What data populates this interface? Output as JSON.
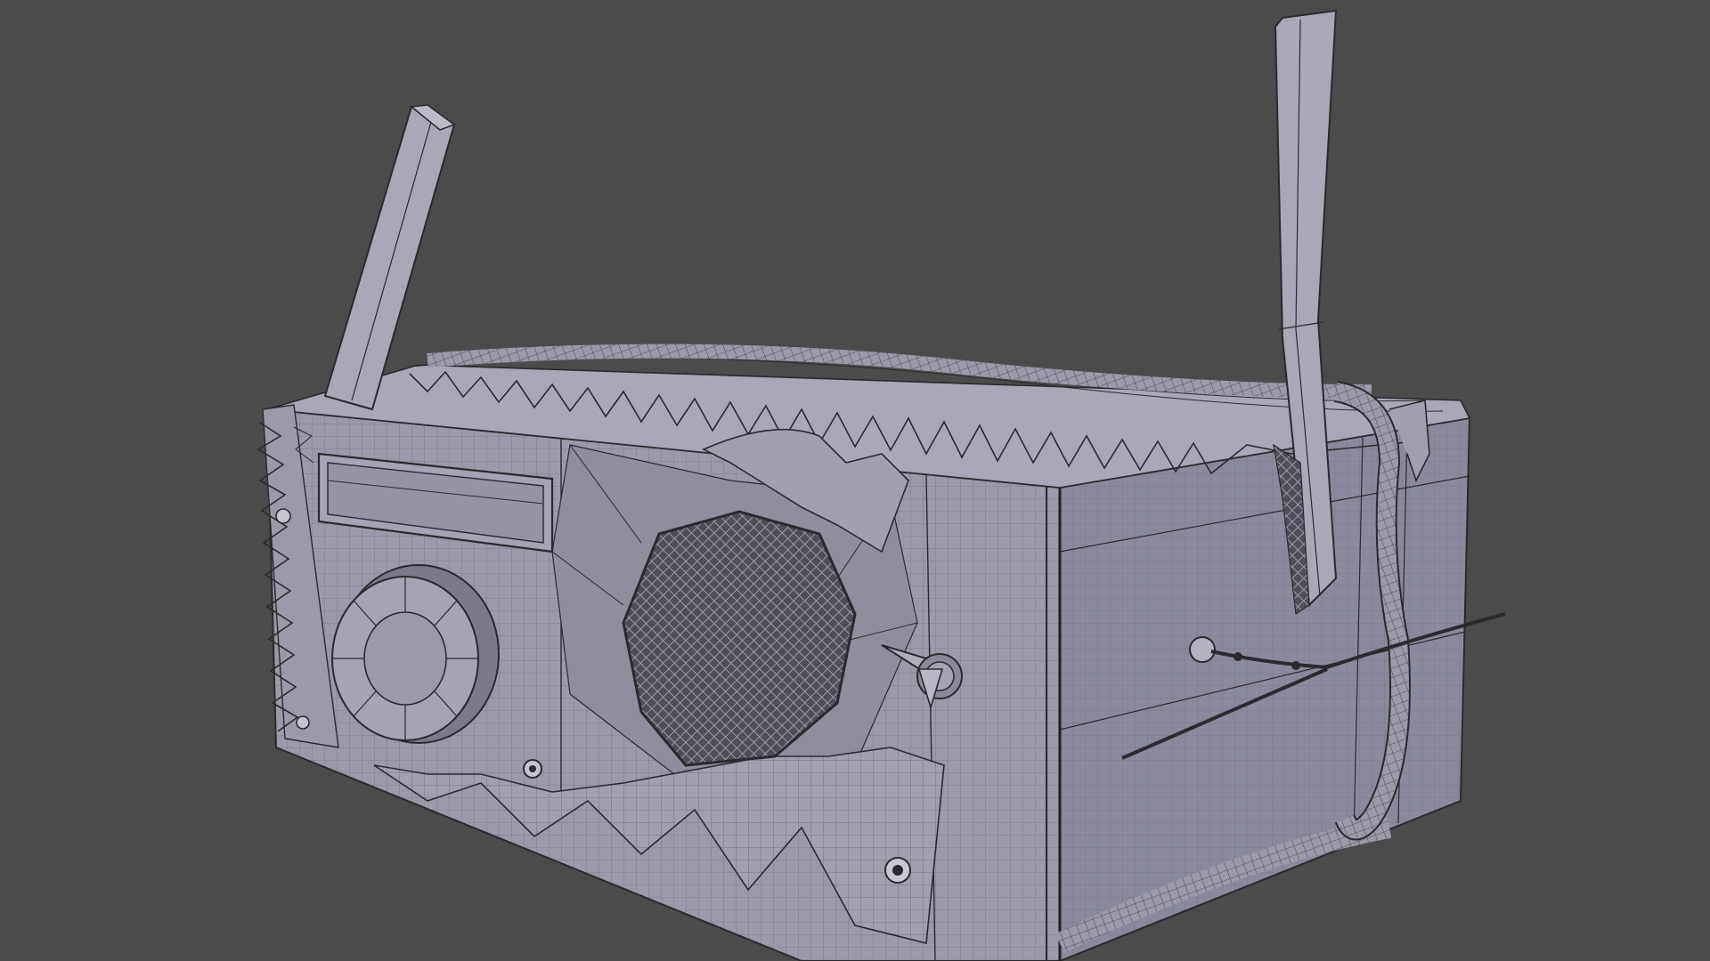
{
  "viewport": {
    "background_color": "#4b4b4b",
    "shading_mode": "solid-wireframe",
    "object": "retro-radio-mesh"
  },
  "colors": {
    "mesh_face_light": "#a4a4b2",
    "mesh_face_mid": "#8e8e9c",
    "mesh_face_dark": "#6f6f7c",
    "mesh_face_side": "#86869a",
    "wireframe": "#2a2a2e",
    "grille": "#5d5d66"
  },
  "icons": {
    "knob": "dial-knob-icon",
    "screw": "screw-icon",
    "speaker": "speaker-grille-icon"
  }
}
